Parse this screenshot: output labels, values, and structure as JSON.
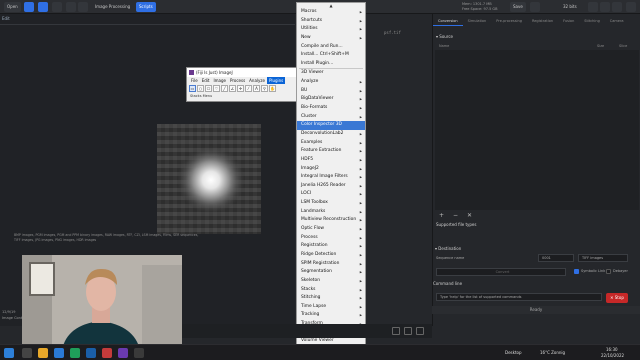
{
  "topbar": {
    "open_label": "Open",
    "image_processing_label": "Image Processing",
    "scripts_label": "Scripts",
    "memory_used": "Mem: 1301.7 MB",
    "memory_free": "Free Space: 97.5 GB",
    "save_label": "Save",
    "zoom_label": "32 bits",
    "colors": {
      "accent": "#2f6fe4"
    }
  },
  "left_panel": {
    "tab_label": "Edit",
    "file_name": "psf.tif",
    "side_label_1": "12/9/19",
    "side_label_2": "Image Cont"
  },
  "imagej": {
    "title": "(Fiji Is Just) ImageJ",
    "menus": [
      "File",
      "Edit",
      "Image",
      "Process",
      "Analyze",
      "Plugins"
    ],
    "active_menu": "Plugins",
    "status": "Stacks Menu",
    "close_label": "X",
    "more_label": "≫"
  },
  "plugins_menu": {
    "items": [
      {
        "label": "Macros",
        "submenu": true
      },
      {
        "label": "Shortcuts",
        "submenu": true
      },
      {
        "label": "Utilities",
        "submenu": true
      },
      {
        "label": "New",
        "submenu": true
      },
      {
        "label": "Compile and Run...",
        "submenu": false
      },
      {
        "label": "Install...   Ctrl+Shift+M",
        "submenu": false
      },
      {
        "label": "Install Plugin...",
        "submenu": false
      },
      {
        "label": "3D Viewer",
        "submenu": false,
        "separator_before": true
      },
      {
        "label": "Analyze",
        "submenu": true
      },
      {
        "label": "BU",
        "submenu": true
      },
      {
        "label": "BigDataViewer",
        "submenu": true
      },
      {
        "label": "Bio-Formats",
        "submenu": true
      },
      {
        "label": "Cluster",
        "submenu": true
      },
      {
        "label": "Color Inspector 3D",
        "submenu": false,
        "highlighted": true
      },
      {
        "label": "DeconvolutionLab2",
        "submenu": true
      },
      {
        "label": "Examples",
        "submenu": true
      },
      {
        "label": "Feature Extraction",
        "submenu": true
      },
      {
        "label": "HDF5",
        "submenu": true
      },
      {
        "label": "ImageJ2",
        "submenu": true
      },
      {
        "label": "Integral Image Filters",
        "submenu": true
      },
      {
        "label": "Janelia H265 Reader",
        "submenu": true
      },
      {
        "label": "LOCI",
        "submenu": true
      },
      {
        "label": "LSM Toolbox",
        "submenu": true
      },
      {
        "label": "Landmarks",
        "submenu": true
      },
      {
        "label": "Multiview Reconstruction",
        "submenu": true
      },
      {
        "label": "Optic Flow",
        "submenu": true
      },
      {
        "label": "Process",
        "submenu": true
      },
      {
        "label": "Registration",
        "submenu": true
      },
      {
        "label": "Ridge Detection",
        "submenu": true
      },
      {
        "label": "SPIM Registration",
        "submenu": true
      },
      {
        "label": "Segmentation",
        "submenu": true
      },
      {
        "label": "Skeleton",
        "submenu": true
      },
      {
        "label": "Stacks",
        "submenu": true
      },
      {
        "label": "Stitching",
        "submenu": true
      },
      {
        "label": "Time Lapse",
        "submenu": true
      },
      {
        "label": "Tracking",
        "submenu": true
      },
      {
        "label": "Transform",
        "submenu": true
      },
      {
        "label": "Utilities",
        "submenu": true
      },
      {
        "label": "Volume Viewer",
        "submenu": false
      }
    ]
  },
  "right_panel": {
    "tabs": [
      "Conversion",
      "Simulation",
      "Pre-processing",
      "Registration",
      "Fusion",
      "Stitching",
      "Camera"
    ],
    "active_tab": "Conversion",
    "source_heading": "Source",
    "columns": [
      "Name",
      "Size",
      "Slice"
    ],
    "supported_heading": "Supported file types",
    "supported_text": "BMP images, PGM images, PGM and PPM binary images, RAW images, RTF, CZI, LSM images, Films, SER sequences, TIFF images, JPG images, PNG images, HDR images",
    "destination_heading": "Destination",
    "sequence_label": "Sequence name",
    "sequence_value": "0001",
    "format_value": "TIFF images",
    "convert_label": "Convert",
    "symbolic_label": "Symbolic Link",
    "debayer_label": "Debayer",
    "command_heading": "Command line",
    "command_placeholder": "Type 'help' for the list of supported commands",
    "stop_label": "Stop",
    "ready_label": "Ready"
  },
  "taskbar": {
    "desktop_label": "Desktop",
    "weather": "16°C  Zonnig",
    "time": "16:30",
    "date": "22/10/2022"
  }
}
